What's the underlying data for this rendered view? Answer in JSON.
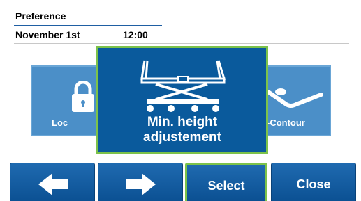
{
  "header": {
    "title": "Preference",
    "date": "November 1st",
    "time": "12:00"
  },
  "tiles": {
    "left": {
      "label": "Loc",
      "icon": "lock-icon"
    },
    "right": {
      "label": "-Contour",
      "icon": "contour-icon"
    }
  },
  "popup": {
    "line1": "Min. height",
    "line2": "adjustement",
    "icon": "bed-icon"
  },
  "buttons": {
    "back": {
      "icon": "arrow-left-icon"
    },
    "next": {
      "icon": "arrow-right-icon"
    },
    "select": "Select",
    "close": "Close"
  },
  "colors": {
    "primary": "#0a5a9c",
    "tile": "#4b8fc8",
    "accent": "#7cc24a"
  }
}
